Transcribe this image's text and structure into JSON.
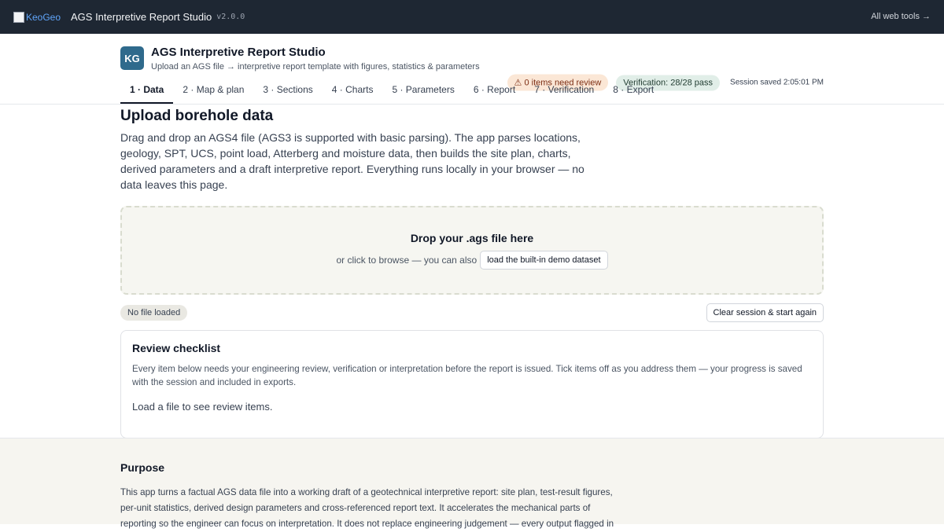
{
  "topbar": {
    "logo_alt": "KeoGeo",
    "title": "AGS Interpretive Report Studio",
    "version": "v2.0.0",
    "all_tools": "All web tools →"
  },
  "header": {
    "badge": "KG",
    "title": "AGS Interpretive Report Studio",
    "subtitle": "Upload an AGS file → interpretive report template with figures, statistics & parameters",
    "review_pill": "⚠ 0 items need review",
    "verification_pill": "Verification: 28/28 pass",
    "session_saved": "Session saved 2:05:01 PM"
  },
  "tabs": [
    {
      "label": "1 · Data",
      "active": true
    },
    {
      "label": "2 · Map & plan"
    },
    {
      "label": "3 · Sections"
    },
    {
      "label": "4 · Charts"
    },
    {
      "label": "5 · Parameters"
    },
    {
      "label": "6 · Report"
    },
    {
      "label": "7 · Verification"
    },
    {
      "label": "8 · Export"
    }
  ],
  "upload": {
    "title": "Upload borehole data",
    "intro": "Drag and drop an AGS4 file (AGS3 is supported with basic parsing). The app parses locations, geology, SPT, UCS, point load, Atterberg and moisture data, then builds the site plan, charts, derived parameters and a draft interpretive report. Everything runs locally in your browser — no data leaves this page.",
    "dropzone_title": "Drop your .ags file here",
    "dropzone_sub": "or click to browse — you can also",
    "demo_button": "load the built-in demo dataset",
    "file_status": "No file loaded",
    "clear_button": "Clear session & start again"
  },
  "checklist": {
    "title": "Review checklist",
    "text": "Every item below needs your engineering review, verification or interpretation before the report is issued. Tick items off as you address them — your progress is saved with the session and included in exports.",
    "empty": "Load a file to see review items."
  },
  "purpose": {
    "title": "Purpose",
    "text": "This app turns a factual AGS data file into a working draft of a geotechnical interpretive report: site plan, test-result figures, per-unit statistics, derived design parameters and cross-referenced report text. It accelerates the mechanical parts of reporting so the engineer can focus on interpretation. It does not replace engineering judgement — every output flagged in"
  },
  "colors": {
    "topbar": "#1e2733",
    "brand": "#2f6a8c",
    "warn_bg": "#fbe7d6",
    "ok_bg": "#e1eee8"
  }
}
